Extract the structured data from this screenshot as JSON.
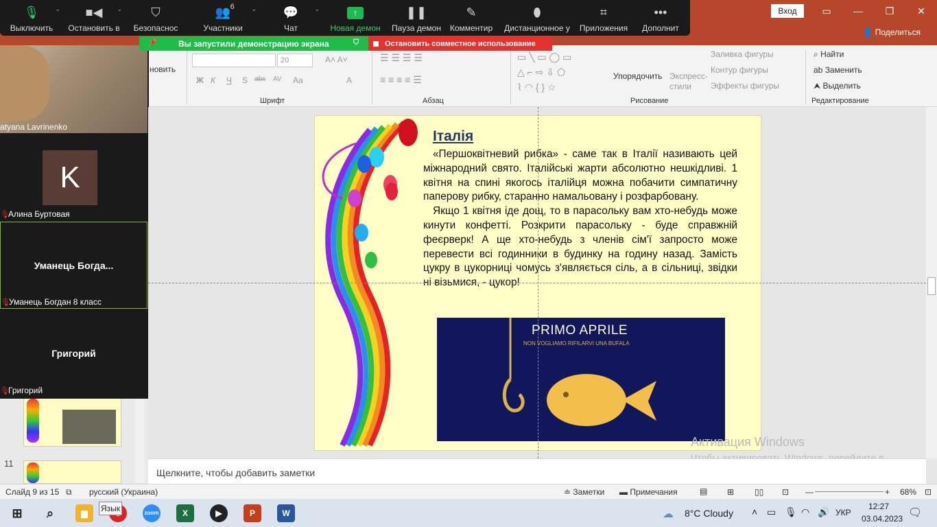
{
  "powerpoint": {
    "login_label": "Вход",
    "share_label": "Поделиться",
    "ribbon": {
      "groups": [
        "Шрифт",
        "Абзац",
        "Рисование",
        "Редактирование"
      ],
      "new_slide_partial": "новить",
      "font_size": "20",
      "arrange_label": "Упорядочить",
      "quick_styles_line1": "Экспресс-",
      "quick_styles_line2": "стили",
      "fill_label": "Заливка фигуры",
      "outline_label": "Контур фигуры",
      "effects_label": "Эффекты фигуры",
      "find_label": "Найти",
      "replace_label": "Заменить",
      "select_label": "Выделить",
      "font_buttons": [
        "Ж",
        "К",
        "Ч",
        "S",
        "abc",
        "AV",
        "Aa",
        "A"
      ]
    },
    "slide": {
      "title": "Італія",
      "paragraph1": "«Першоквітневий рибка» - саме так в Італії називають цей міжнародний свято. Італійські жарти абсолютно нешкідливі. 1 квітня на спині якогось італійця можна побачити симпатичну паперову рибку, старанно намальовану і розфарбовану.",
      "paragraph2": "Якщо 1 квітня іде дощ, то в парасольку вам хто-небудь може кинути конфетті. Розкрити парасольку - буде справжній феєрверк! А ще хто-небудь з членів сім'ї запросто може перевести всі годинники в будинку на годину назад. Замість цукру в цукорниці чомусь з'являється сіль, а в сільниці, звідки ні візьмися, - цукор!",
      "image_title": "PRIMO APRILE",
      "image_subtitle": "NON VOGLIAMO RIFILARVI UNA BUFALA"
    },
    "thumbnail_number": "11",
    "notes_placeholder": "Щелкните, чтобы добавить заметки",
    "status": {
      "slide_info": "Слайд 9 из 15",
      "language": "русский (Украина)",
      "notes_btn": "Заметки",
      "comments_btn": "Примечания",
      "zoom": "68%"
    },
    "activation": {
      "title": "Активация Windows",
      "text": "Чтобы активировать Windows, перейдите в раздел \"Параметры\"."
    }
  },
  "zoom": {
    "toolbar": [
      {
        "label": "Выключить",
        "icon": "microphone-icon"
      },
      {
        "label": "Остановить в",
        "icon": "video-camera-icon"
      },
      {
        "label": "Безопаснос",
        "icon": "shield-icon"
      },
      {
        "label": "Участники",
        "icon": "participants-icon",
        "badge": "6"
      },
      {
        "label": "Чат",
        "icon": "chat-icon"
      },
      {
        "label": "Новая демон",
        "icon": "share-screen-icon"
      },
      {
        "label": "Пауза демон",
        "icon": "pause-icon"
      },
      {
        "label": "Комментир",
        "icon": "pen-icon"
      },
      {
        "label": "Дистанционное у",
        "icon": "mouse-icon"
      },
      {
        "label": "Приложения",
        "icon": "apps-icon"
      },
      {
        "label": "Дополнит",
        "icon": "more-icon"
      }
    ],
    "share_banner": "Вы запустили демонстрацию экрана",
    "stop_share": "Остановить совместное использование",
    "participants": [
      {
        "name": "atyana Lavrinenko"
      },
      {
        "name": "Алина Буртовая",
        "avatar_letter": "K"
      },
      {
        "name": "Уманець Богдан 8 класс",
        "display": "Уманець  Богда..."
      },
      {
        "name": "Григорий",
        "display": "Григорий"
      }
    ]
  },
  "taskbar": {
    "tooltip": "Язык",
    "weather": "8°C  Cloudy",
    "lang": "УКР",
    "time": "12:27",
    "date": "03.04.2023"
  },
  "colors": {
    "powerpoint_red": "#b7472a",
    "zoom_green": "#1ebd48",
    "zoom_red": "#e5322f",
    "slide_bg": "#ffffc6"
  }
}
